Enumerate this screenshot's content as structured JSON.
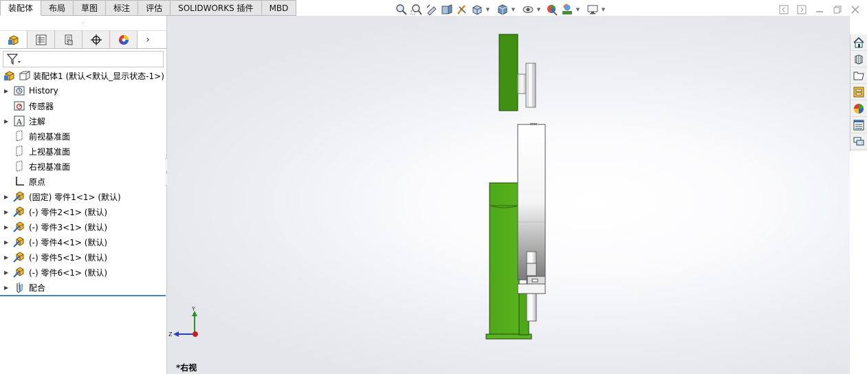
{
  "tabs": [
    {
      "label": "装配体",
      "active": true
    },
    {
      "label": "布局",
      "active": false
    },
    {
      "label": "草图",
      "active": false
    },
    {
      "label": "标注",
      "active": false
    },
    {
      "label": "评估",
      "active": false
    },
    {
      "label": "SOLIDWORKS 插件",
      "active": false
    },
    {
      "label": "MBD",
      "active": false
    }
  ],
  "heads_up_toolbar": [
    "zoom-to-fit-icon",
    "zoom-to-area-icon",
    "previous-view-icon",
    "section-view-icon",
    "dynamic-annotation-icon",
    "view-orientation-icon",
    "display-style-icon",
    "hide-show-items-icon",
    "edit-appearance-icon",
    "apply-scene-icon",
    "view-settings-icon"
  ],
  "tree": {
    "root": "装配体1  (默认<默认_显示状态-1>)",
    "items": [
      {
        "label": "History",
        "icon": "history-icon",
        "expandable": true
      },
      {
        "label": "传感器",
        "icon": "sensor-icon",
        "expandable": false
      },
      {
        "label": "注解",
        "icon": "annotation-icon",
        "expandable": true
      },
      {
        "label": "前视基准面",
        "icon": "plane-icon",
        "expandable": false
      },
      {
        "label": "上视基准面",
        "icon": "plane-icon",
        "expandable": false
      },
      {
        "label": "右视基准面",
        "icon": "plane-icon",
        "expandable": false
      },
      {
        "label": "原点",
        "icon": "origin-icon",
        "expandable": false
      },
      {
        "label": "(固定) 零件1<1> (默认)",
        "icon": "part-icon",
        "expandable": true
      },
      {
        "label": "(-) 零件2<1> (默认)",
        "icon": "part-icon",
        "expandable": true
      },
      {
        "label": "(-) 零件3<1> (默认)",
        "icon": "part-icon",
        "expandable": true
      },
      {
        "label": "(-) 零件4<1> (默认)",
        "icon": "part-icon",
        "expandable": true
      },
      {
        "label": "(-) 零件5<1> (默认)",
        "icon": "part-icon",
        "expandable": true
      },
      {
        "label": "(-) 零件6<1> (默认)",
        "icon": "part-icon",
        "expandable": true
      },
      {
        "label": "配合",
        "icon": "mates-icon",
        "expandable": true
      }
    ]
  },
  "triad": {
    "y_label": "Y",
    "z_label": "Z"
  },
  "view_label": "*右视",
  "colors": {
    "part_green": "#4fa818",
    "part_dark_green": "#3a8a12",
    "accent_blue": "#3d8ab8"
  }
}
